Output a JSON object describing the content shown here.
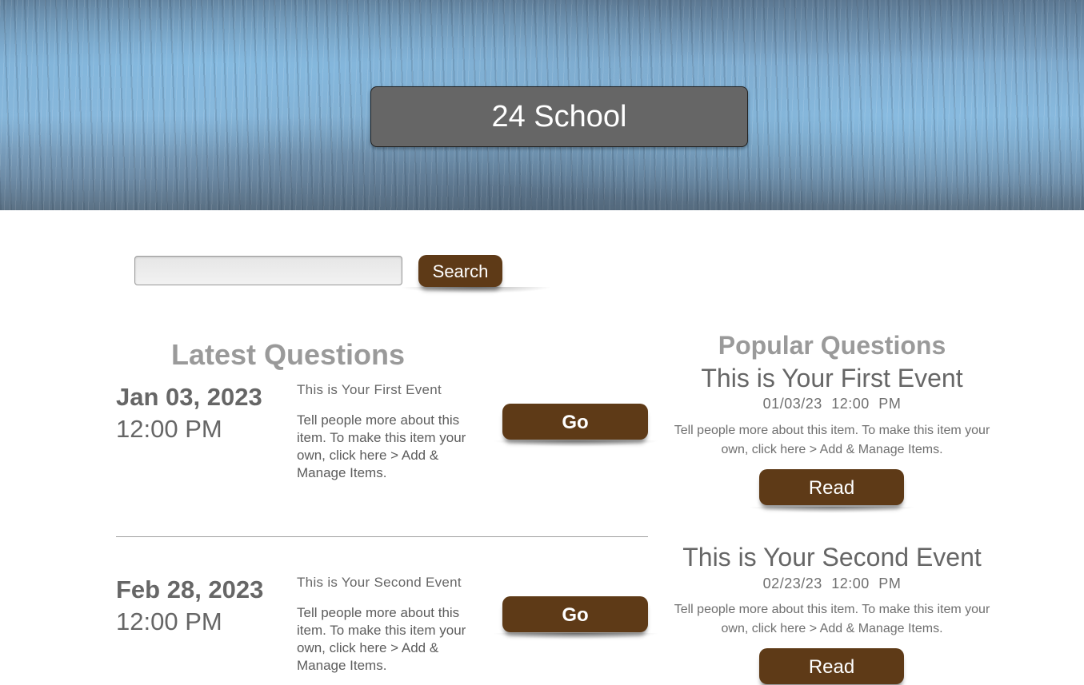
{
  "header": {
    "title": "24 School"
  },
  "search": {
    "value": "",
    "button_label": "Search"
  },
  "latest": {
    "heading": "Latest Questions",
    "items": [
      {
        "date": "Jan 03, 2023",
        "time": "12:00 PM",
        "title": "This is Your First Event",
        "description": "Tell people more about this item. To make this item your own, click here > Add & Manage Items.",
        "button_label": "Go"
      },
      {
        "date": "Feb 28, 2023",
        "time": "12:00 PM",
        "title": "This is Your Second Event",
        "description": "Tell people more about this item. To make this item your own, click here > Add & Manage Items.",
        "button_label": "Go"
      }
    ]
  },
  "popular": {
    "heading": "Popular Questions",
    "items": [
      {
        "title": "This is Your First Event",
        "date": "01/03/23",
        "time": "12:00 PM",
        "description": "Tell people more about this item. To make this item your own, click here > Add & Manage Items.",
        "button_label": "Read"
      },
      {
        "title": "This is Your Second Event",
        "date": "02/23/23",
        "time": "12:00 PM",
        "description": "Tell people more about this item. To make this item your own, click here > Add & Manage Items.",
        "button_label": "Read"
      }
    ]
  },
  "colors": {
    "button_brown": "#5e3a17",
    "title_box_gray": "#666666",
    "heading_gray": "#9a9a9a"
  }
}
